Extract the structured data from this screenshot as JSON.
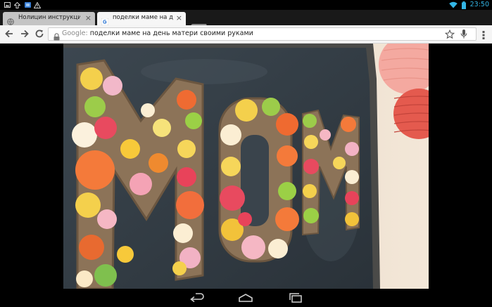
{
  "status_bar": {
    "time": "23:50",
    "left_icons": [
      "picture-notification-icon",
      "upload-notification-icon",
      "app-notification-icon",
      "warning-notification-icon"
    ],
    "right_icons": [
      "wifi-icon",
      "battery-icon"
    ],
    "accent_color": "#33b5e5"
  },
  "browser": {
    "tabs": [
      {
        "title": "Нолицин инструкция по",
        "favicon": "globe-icon",
        "active": false
      },
      {
        "title": "поделки маме на день матер",
        "favicon": "google-icon",
        "active": true
      }
    ],
    "omnibox": {
      "engine_label": "Google:",
      "query": "поделки маме на день матери своими руками"
    }
  },
  "content": {
    "image": "decorative cardboard letters filled with paper flowers on a chalkboard"
  },
  "nav_bar": {
    "buttons": [
      "back",
      "home",
      "recent-apps"
    ]
  }
}
